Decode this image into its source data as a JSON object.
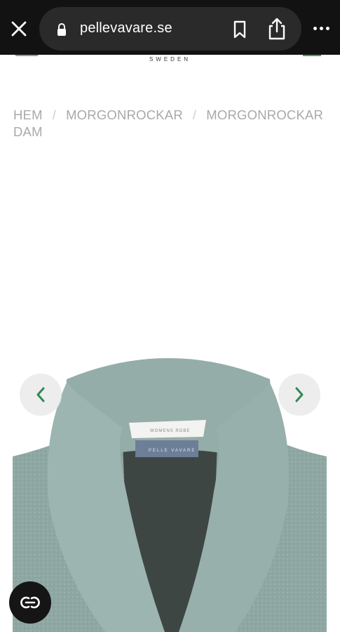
{
  "browser": {
    "url": "pellevavare.se",
    "close_icon": "close-icon",
    "lock_icon": "lock-icon",
    "bookmark_icon": "bookmark-icon",
    "share_icon": "share-icon",
    "more_icon": "more-icon"
  },
  "site_header": {
    "brand_subtitle": "SWEDEN",
    "accent_color": "#49a06a"
  },
  "breadcrumb": {
    "items": [
      "HEM",
      "MORGONROCKAR",
      "MORGONROCKAR DAM"
    ],
    "separator": "/"
  },
  "product_image": {
    "label_text": "WOMENS ROBE",
    "tag_text": "PELLE VAVARE",
    "prev_icon": "chevron-left-icon",
    "next_icon": "chevron-right-icon",
    "arrow_color": "#2f8a55",
    "robe_color": "#8fa8a3"
  },
  "chat": {
    "icon": "chat-icon"
  }
}
